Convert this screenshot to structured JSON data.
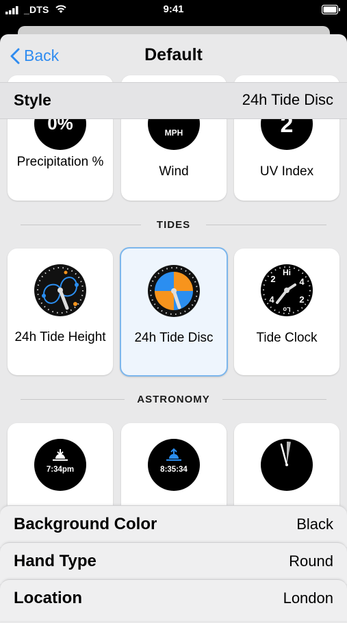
{
  "status_bar": {
    "carrier": "DTS",
    "time": "9:41"
  },
  "nav": {
    "back_label": "Back",
    "title": "Default"
  },
  "style_row": {
    "label": "Style",
    "value": "24h Tide Disc"
  },
  "weather_row": [
    {
      "label": "Precipitation %",
      "dial_text": "0%"
    },
    {
      "label": "Wind",
      "dial_text": "MPH"
    },
    {
      "label": "UV Index",
      "dial_text": "2"
    }
  ],
  "sections": {
    "tides": "TIDES",
    "astronomy": "ASTRONOMY"
  },
  "tides_row": [
    {
      "label": "24h Tide Height",
      "selected": false
    },
    {
      "label": "24h Tide Disc",
      "selected": true
    },
    {
      "label": "Tide Clock",
      "selected": false,
      "dial_marks": [
        "Hi",
        "Lo",
        "2",
        "4",
        "4",
        "2"
      ]
    }
  ],
  "astronomy_row": [
    {
      "dial_text": "7:34pm"
    },
    {
      "dial_text": "8:35:34"
    },
    {
      "dial_text": ""
    }
  ],
  "settings": [
    {
      "label": "Background Color",
      "value": "Black"
    },
    {
      "label": "Hand Type",
      "value": "Round"
    },
    {
      "label": "Location",
      "value": "London"
    }
  ],
  "colors": {
    "accent": "#2f8cf0",
    "orange": "#f7941d",
    "blue": "#2b8ef0",
    "selected_border": "#7cb6ec"
  }
}
